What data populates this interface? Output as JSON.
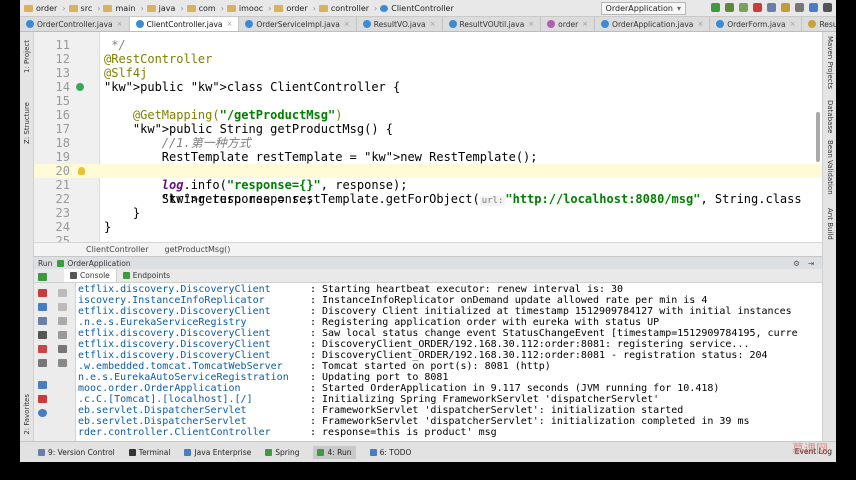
{
  "breadcrumb": [
    "order",
    "src",
    "main",
    "java",
    "com",
    "imooc",
    "order",
    "controller",
    "ClientController"
  ],
  "run_config": "OrderApplication",
  "tabs": [
    {
      "label": "OrderController.java",
      "active": false
    },
    {
      "label": "ClientController.java",
      "active": true
    },
    {
      "label": "OrderServiceImpl.java",
      "active": false
    },
    {
      "label": "ResultVO.java",
      "active": false
    },
    {
      "label": "ResultVOUtil.java",
      "active": false
    },
    {
      "label": "order",
      "active": false
    },
    {
      "label": "OrderApplication.java",
      "active": false
    },
    {
      "label": "OrderForm.java",
      "active": false
    },
    {
      "label": "ResultEnum.java",
      "active": false
    }
  ],
  "left_strip": [
    "1: Project",
    "Z: Structure",
    "2: Favorites"
  ],
  "right_strip": [
    "Maven Projects",
    "Database",
    "Bean Validation",
    "Ant Build"
  ],
  "editor": {
    "line_numbers": [
      "11",
      "12",
      "13",
      "14",
      "15",
      "16",
      "17",
      "18",
      "19",
      "20",
      "21",
      "22",
      "23",
      "24",
      "25"
    ],
    "lines": [
      " */",
      "@RestController",
      "@Slf4j",
      "public class ClientController {",
      "",
      "    @GetMapping(\"/getProductMsg\")",
      "    public String getProductMsg() {",
      "        //1.第一种方式",
      "        RestTemplate restTemplate = new RestTemplate();",
      "        String response = restTemplate.getForObject(",
      "        log.info(\"response={}\", response);",
      "        return response;",
      "    }",
      "}",
      ""
    ],
    "hint_url": "url:",
    "url_literal": "\"http://localhost:8080/msg\"",
    "after_url": ", String.class",
    "first_line_fragment": "* ",
    "current_line": 20
  },
  "editor_breadcrumb": [
    "ClientController",
    "getProductMsg()"
  ],
  "run_panel": {
    "title": "Run",
    "app": "OrderApplication",
    "subtabs": [
      "Console",
      "Endpoints"
    ]
  },
  "console": [
    {
      "cls": "etflix.discovery.DiscoveryClient",
      "msg": ": Starting heartbeat executor: renew interval is: 30"
    },
    {
      "cls": "iscovery.InstanceInfoReplicator",
      "msg": ": InstanceInfoReplicator onDemand update allowed rate per min is 4"
    },
    {
      "cls": "etflix.discovery.DiscoveryClient",
      "msg": ": Discovery Client initialized at timestamp 1512909784127 with initial instances"
    },
    {
      "cls": ".n.e.s.EurekaServiceRegistry",
      "msg": ": Registering application order with eureka with status UP"
    },
    {
      "cls": "etflix.discovery.DiscoveryClient",
      "msg": ": Saw local status change event StatusChangeEvent [timestamp=1512909784195, curre"
    },
    {
      "cls": "etflix.discovery.DiscoveryClient",
      "msg": ": DiscoveryClient_ORDER/192.168.30.112:order:8081: registering service..."
    },
    {
      "cls": "etflix.discovery.DiscoveryClient",
      "msg": ": DiscoveryClient_ORDER/192.168.30.112:order:8081 - registration status: 204"
    },
    {
      "cls": ".w.embedded.tomcat.TomcatWebServer",
      "msg": ": Tomcat started on port(s): 8081 (http)"
    },
    {
      "cls": "n.e.s.EurekaAutoServiceRegistration",
      "msg": ": Updating port to 8081"
    },
    {
      "cls": "mooc.order.OrderApplication",
      "msg": ": Started OrderApplication in 9.117 seconds (JVM running for 10.418)"
    },
    {
      "cls": ".c.C.[Tomcat].[localhost].[/]",
      "msg": ": Initializing Spring FrameworkServlet 'dispatcherServlet'"
    },
    {
      "cls": "eb.servlet.DispatcherServlet",
      "msg": ": FrameworkServlet 'dispatcherServlet': initialization started"
    },
    {
      "cls": "eb.servlet.DispatcherServlet",
      "msg": ": FrameworkServlet 'dispatcherServlet': initialization completed in 39 ms"
    },
    {
      "cls": "rder.controller.ClientController",
      "msg": ": response=this is product' msg"
    }
  ],
  "statusbar": [
    "9: Version Control",
    "Terminal",
    "Java Enterprise",
    "Spring",
    "4: Run",
    "6: TODO"
  ],
  "event_log": "Event Log",
  "watermark": "慕课网"
}
